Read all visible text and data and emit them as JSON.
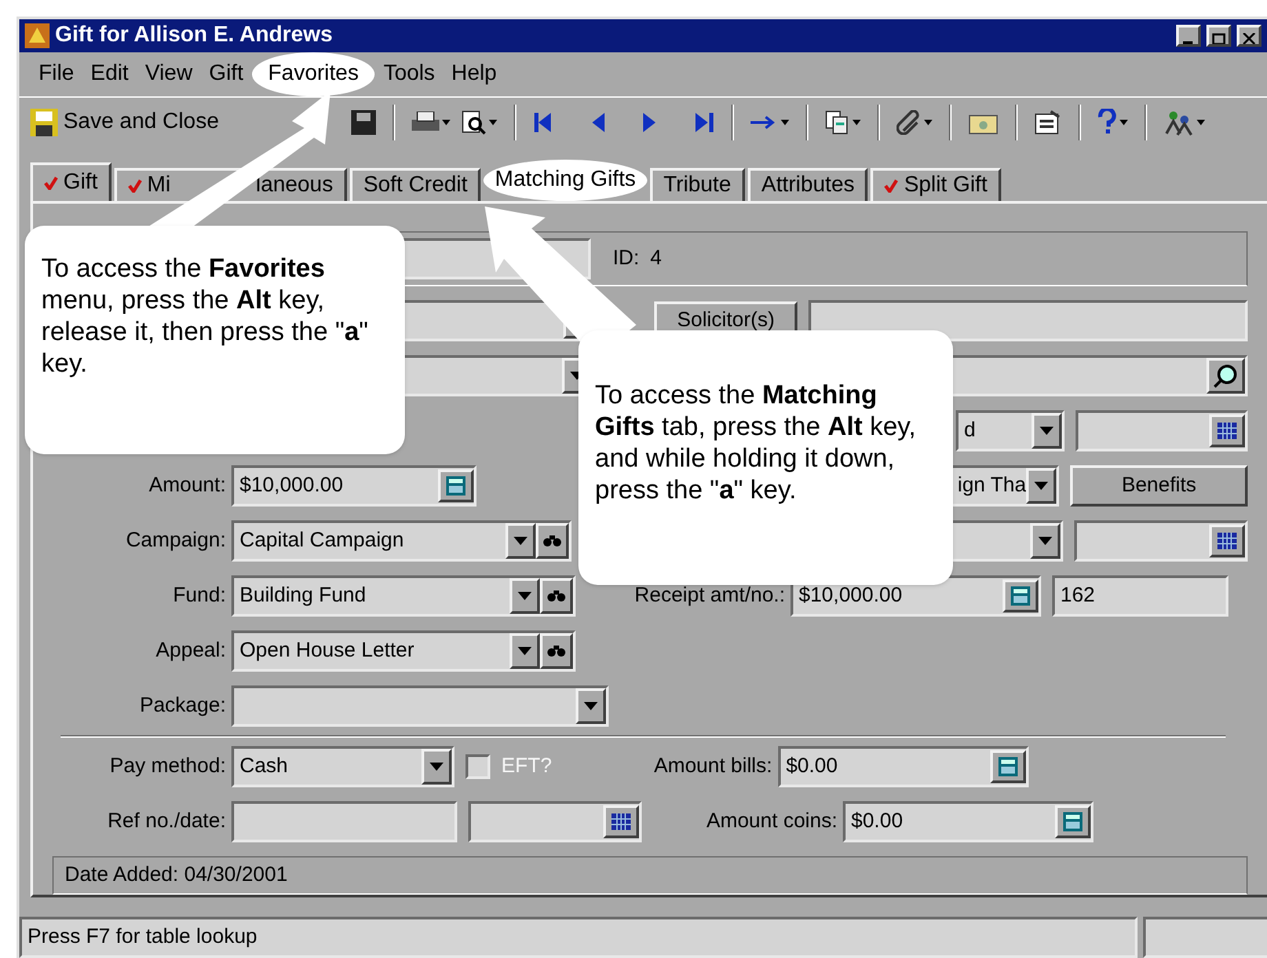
{
  "window": {
    "title": "Gift for Allison E. Andrews"
  },
  "menu": [
    {
      "label": "File",
      "highlighted": false
    },
    {
      "label": "Edit",
      "highlighted": false
    },
    {
      "label": "View",
      "highlighted": false
    },
    {
      "label": "Gift",
      "highlighted": false
    },
    {
      "label": "Favorites",
      "highlighted": true
    },
    {
      "label": "Tools",
      "highlighted": false
    },
    {
      "label": "Help",
      "highlighted": false
    }
  ],
  "toolbar": {
    "save_close": "Save and Close"
  },
  "tabs": [
    {
      "label": "Gift",
      "checked": true,
      "selected": true
    },
    {
      "label": "Mi",
      "label_rest": "laneous",
      "checked": true,
      "selected": false
    },
    {
      "label": "Soft Credit",
      "checked": false,
      "selected": false
    },
    {
      "label": "Matching Gifts",
      "checked": false,
      "selected": false,
      "highlighted": true
    },
    {
      "label": "Tribute",
      "checked": false,
      "selected": false
    },
    {
      "label": "Attributes",
      "checked": false,
      "selected": false
    },
    {
      "label": "Split Gift",
      "checked": true,
      "selected": false
    }
  ],
  "form": {
    "id_label": "ID:",
    "id_value": "4",
    "solicitor_button": "Solicitor(s)",
    "right_dropdown_1": "d",
    "right_dropdown_2": "ign Tha",
    "benefits_button": "Benefits",
    "amount": {
      "label": "Amount:",
      "value": "$10,000.00"
    },
    "campaign": {
      "label": "Campaign:",
      "value": "Capital Campaign"
    },
    "fund": {
      "label": "Fund:",
      "value": "Building Fund"
    },
    "appeal": {
      "label": "Appeal:",
      "value": "Open House Letter"
    },
    "package": {
      "label": "Package:"
    },
    "receipt": {
      "label": "Receipt amt/no.:",
      "amount": "$10,000.00",
      "number": "162"
    },
    "pay_method": {
      "label": "Pay method:",
      "value": "Cash"
    },
    "eft": {
      "label": "EFT?",
      "checked": false,
      "disabled": true
    },
    "amount_bills": {
      "label": "Amount bills:",
      "value": "$0.00"
    },
    "ref": {
      "label": "Ref no./date:"
    },
    "amount_coins": {
      "label": "Amount coins:",
      "value": "$0.00"
    },
    "date_added": "Date Added:  04/30/2001"
  },
  "callouts": [
    {
      "text": "To access the **Favorites** menu, press the **Alt** key, release it, then press the \"**a**\" key."
    },
    {
      "text": "To access the **Matching Gifts** tab, press the **Alt** key, and while holding it down, press the \"**a**\" key."
    }
  ],
  "status_bar": {
    "text": "Press F7 for table lookup"
  }
}
